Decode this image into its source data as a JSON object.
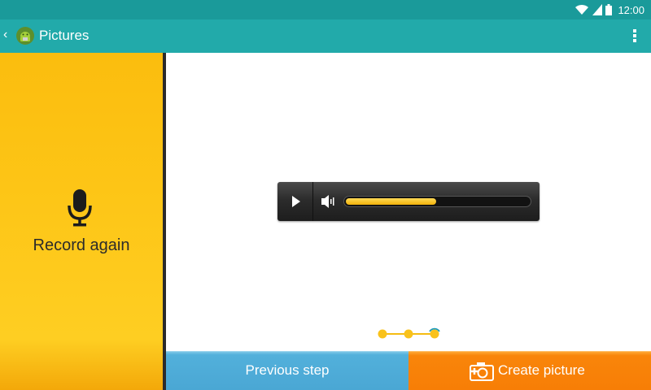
{
  "status_bar": {
    "time": "12:00",
    "icons": [
      "wifi-icon",
      "cell-signal-icon",
      "battery-icon"
    ]
  },
  "action_bar": {
    "title": "Pictures",
    "back_icon": "chevron-left-icon",
    "app_icon": "android-app-icon",
    "menu_icon": "overflow-menu-icon"
  },
  "record_panel": {
    "label": "Record again",
    "icon": "microphone-icon"
  },
  "audio_player": {
    "play_icon": "play-icon",
    "volume_icon": "volume-icon",
    "progress": 0.5
  },
  "steps": {
    "count": 3,
    "current": 3
  },
  "footer": {
    "previous_label": "Previous step",
    "create_label": "Create picture",
    "create_icon": "camera-icon"
  },
  "colors": {
    "status_bar": "#1a9a9a",
    "action_bar": "#22aaaa",
    "record_panel": "#fdc516",
    "previous_button": "#4aa7d4",
    "create_button": "#f77e06",
    "progress": "#f5c21c"
  }
}
